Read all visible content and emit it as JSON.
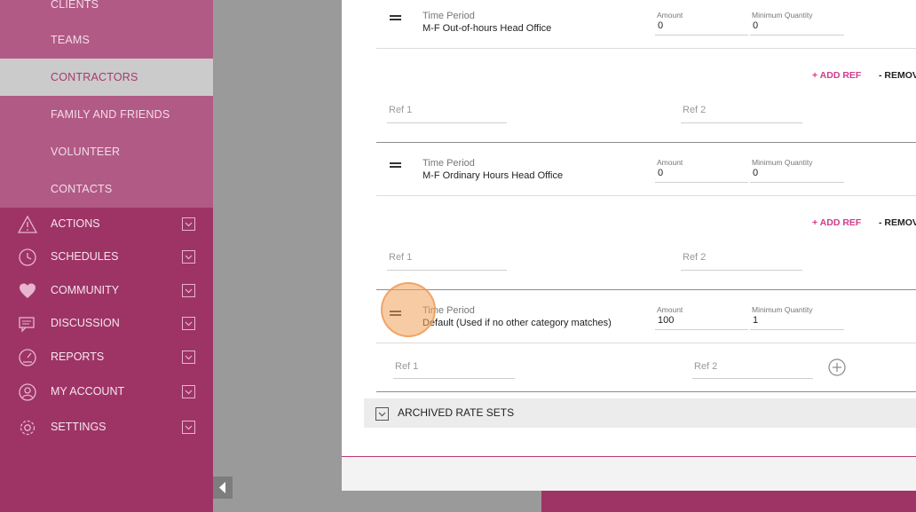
{
  "sidebar": {
    "sub_items": [
      {
        "label": "Clients",
        "active": false
      },
      {
        "label": "Teams",
        "active": false
      },
      {
        "label": "Contractors",
        "active": true
      },
      {
        "label": "Family and Friends",
        "active": false
      },
      {
        "label": "Volunteer",
        "active": false
      },
      {
        "label": "Contacts",
        "active": false
      }
    ],
    "nav_items": [
      {
        "label": "Actions",
        "icon": "warning-icon"
      },
      {
        "label": "Schedules",
        "icon": "clock-icon"
      },
      {
        "label": "Community",
        "icon": "heart-icon"
      },
      {
        "label": "Discussion",
        "icon": "chat-icon"
      },
      {
        "label": "Reports",
        "icon": "gauge-icon"
      },
      {
        "label": "My Account",
        "icon": "user-icon"
      },
      {
        "label": "Settings",
        "icon": "gear-icon"
      }
    ]
  },
  "rate_rows": [
    {
      "time_period_label": "Time Period",
      "time_period_value": "M-F Out-of-hours Head Office",
      "amount_label": "Amount",
      "amount_value": "0",
      "min_qty_label": "Minimum Quantity",
      "min_qty_value": "0",
      "add_ref_label": "+ ADD REF",
      "remove_ref_label": "- REMOVE REF",
      "ref1_placeholder": "Ref 1",
      "ref2_placeholder": "Ref 2"
    },
    {
      "time_period_label": "Time Period",
      "time_period_value": "M-F Ordinary Hours Head Office",
      "amount_label": "Amount",
      "amount_value": "0",
      "min_qty_label": "Minimum Quantity",
      "min_qty_value": "0",
      "add_ref_label": "+ ADD REF",
      "remove_ref_label": "- REMOVE REF",
      "ref1_placeholder": "Ref 1",
      "ref2_placeholder": "Ref 2"
    },
    {
      "time_period_label": "Time Period",
      "time_period_value": "Default (Used if no other category matches)",
      "amount_label": "Amount",
      "amount_value": "100",
      "min_qty_label": "Minimum Quantity",
      "min_qty_value": "1",
      "ref1_placeholder": "Ref 1",
      "ref2_placeholder": "Ref 2"
    }
  ],
  "archived": {
    "label": "Archived Rate Sets"
  },
  "colors": {
    "accent": "#d23b8a",
    "sidebar": "#9e3466",
    "sidebar_sub": "#b25a86"
  }
}
